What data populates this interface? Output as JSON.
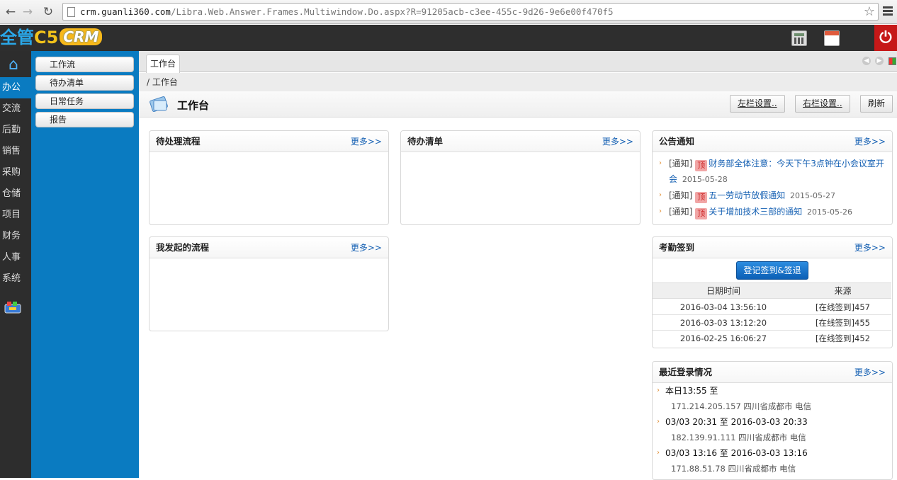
{
  "browser": {
    "url_host": "crm.guanli360.com",
    "url_path": "/Libra.Web.Answer.Frames.Multiwindow.Do.aspx?R=91205acb-c3ee-455c-9d26-9e6e00f470f5"
  },
  "app": {
    "logo_part1": "全管",
    "logo_part2": "C5",
    "logo_part3": "CRM",
    "power_glyph": "⏻"
  },
  "left_nav": [
    {
      "label": "办公",
      "active": true
    },
    {
      "label": "交流"
    },
    {
      "label": "后勤"
    },
    {
      "label": "销售"
    },
    {
      "label": "采购"
    },
    {
      "label": "仓储"
    },
    {
      "label": "项目"
    },
    {
      "label": "财务"
    },
    {
      "label": "人事"
    },
    {
      "label": "系统"
    }
  ],
  "sub_nav": [
    {
      "label": "工作流"
    },
    {
      "label": "待办清单"
    },
    {
      "label": "日常任务"
    },
    {
      "label": "报告"
    }
  ],
  "tabs": [
    {
      "label": "工作台"
    }
  ],
  "breadcrumb": "/ 工作台",
  "page_title": "工作台",
  "toolbar": {
    "left_setting": "左栏设置..",
    "right_setting": "右栏设置..",
    "refresh": "刷新"
  },
  "panels": {
    "pending_flow": {
      "title": "待处理流程",
      "more": "更多>>"
    },
    "todo": {
      "title": "待办清单",
      "more": "更多>>"
    },
    "my_flow": {
      "title": "我发起的流程",
      "more": "更多>>"
    },
    "notice": {
      "title": "公告通知",
      "more": "更多>>",
      "items": [
        {
          "type": "[通知]",
          "tag": "顶",
          "title": "财务部全体注意：今天下午3点钟在小会议室开会",
          "date": "2015-05-28"
        },
        {
          "type": "[通知]",
          "tag": "顶",
          "title": "五一劳动节放假通知",
          "date": "2015-05-27"
        },
        {
          "type": "[通知]",
          "tag": "顶",
          "title": "关于增加技术三部的通知",
          "date": "2015-05-26"
        }
      ]
    },
    "attendance": {
      "title": "考勤签到",
      "more": "更多>>",
      "button": "登记签到&签退",
      "columns": [
        "日期时间",
        "来源"
      ],
      "rows": [
        {
          "time": "2016-03-04 13:56:10",
          "source": "[在线签到]457"
        },
        {
          "time": "2016-03-03 13:12:20",
          "source": "[在线签到]455"
        },
        {
          "time": "2016-02-25 16:06:27",
          "source": "[在线签到]452"
        }
      ]
    },
    "login": {
      "title": "最近登录情况",
      "more": "更多>>",
      "items": [
        {
          "time": "本日13:55 至",
          "ip": "171.214.205.157 四川省成都市 电信"
        },
        {
          "time": "03/03 20:31 至 2016-03-03 20:33",
          "ip": "182.139.91.111 四川省成都市 电信"
        },
        {
          "time": "03/03 13:16 至 2016-03-03 13:16",
          "ip": "171.88.51.78 四川省成都市 电信"
        }
      ]
    }
  }
}
